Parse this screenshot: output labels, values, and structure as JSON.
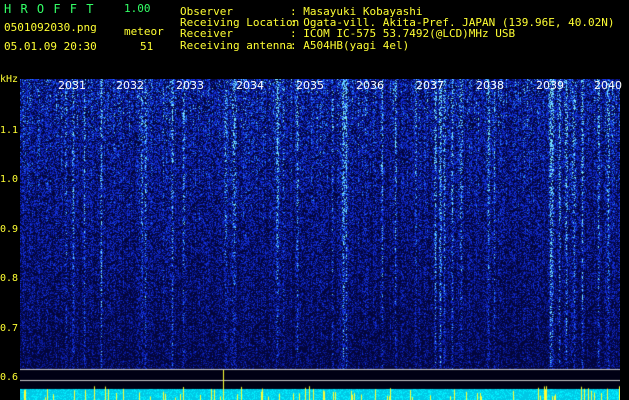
{
  "app": {
    "title": "H R O F F T",
    "version": "1.00",
    "file": "0501092030.png",
    "count_label": "meteor",
    "datetime": "05.01.09 20:30",
    "count": "51"
  },
  "info": {
    "labels": [
      "Observer",
      "Receiving Location",
      "Receiver",
      "Receiving antenna"
    ],
    "values": [
      ": Masayuki Kobayashi",
      ": Ogata-vill. Akita-Pref. JAPAN (139.96E, 40.02N)",
      ": ICOM IC-575 53.7492(@LCD)MHz USB",
      ": A504HB(yagi 4el)"
    ]
  },
  "axis": {
    "unit": "kHz",
    "y_labels": [
      "1.1",
      "1.0",
      "0.9",
      "0.8",
      "0.7",
      "0.6"
    ],
    "x_labels": [
      "2031",
      "2032",
      "2033",
      "2034",
      "2035",
      "2036",
      "2037",
      "2038",
      "2039",
      "2040"
    ]
  },
  "colors": {
    "header_yellow": "#ffff33",
    "header_cyan": "#39f3f3",
    "title_green": "#33ff66",
    "spectrum_blue": "#1a2fd0",
    "baseline_cyan": "#00e5ff"
  }
}
